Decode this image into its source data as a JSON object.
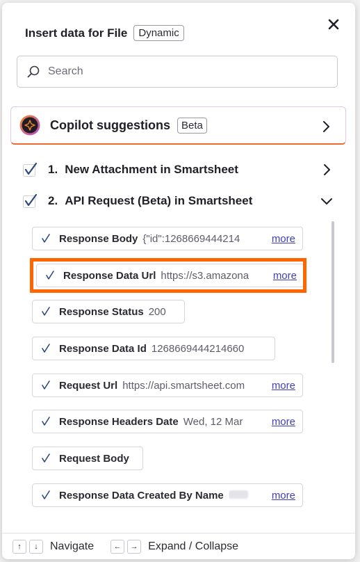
{
  "header": {
    "title": "Insert data for File",
    "badge": "Dynamic"
  },
  "search": {
    "placeholder": "Search",
    "value": ""
  },
  "copilot": {
    "label": "Copilot suggestions",
    "badge": "Beta"
  },
  "steps": [
    {
      "number": "1.",
      "title": "New Attachment in Smartsheet",
      "expanded": false
    },
    {
      "number": "2.",
      "title": "API Request (Beta) in Smartsheet",
      "expanded": true
    }
  ],
  "items": [
    {
      "label": "Response Body",
      "value": "{\"id\":1268669444214",
      "more": "more"
    },
    {
      "label": "Response Data Url",
      "value": "https://s3.amazona",
      "more": "more"
    },
    {
      "label": "Response Status",
      "value": "200",
      "more": ""
    },
    {
      "label": "Response Data Id",
      "value": "1268669444214660",
      "more": ""
    },
    {
      "label": "Request Url",
      "value": "https://api.smartsheet.com",
      "more": "more"
    },
    {
      "label": "Response Headers Date",
      "value": "Wed, 12 Mar",
      "more": "more"
    },
    {
      "label": "Request Body",
      "value": "",
      "more": ""
    },
    {
      "label": "Response Data Created By Name",
      "value": "",
      "more": "more"
    }
  ],
  "footer": {
    "up_key": "↑",
    "down_key": "↓",
    "navigate": "Navigate",
    "left_key": "←",
    "right_key": "→",
    "expand": "Expand / Collapse"
  },
  "colors": {
    "highlight": "#ff6600",
    "link": "#403fb8",
    "copilot_accent": "#ec6a2c"
  }
}
